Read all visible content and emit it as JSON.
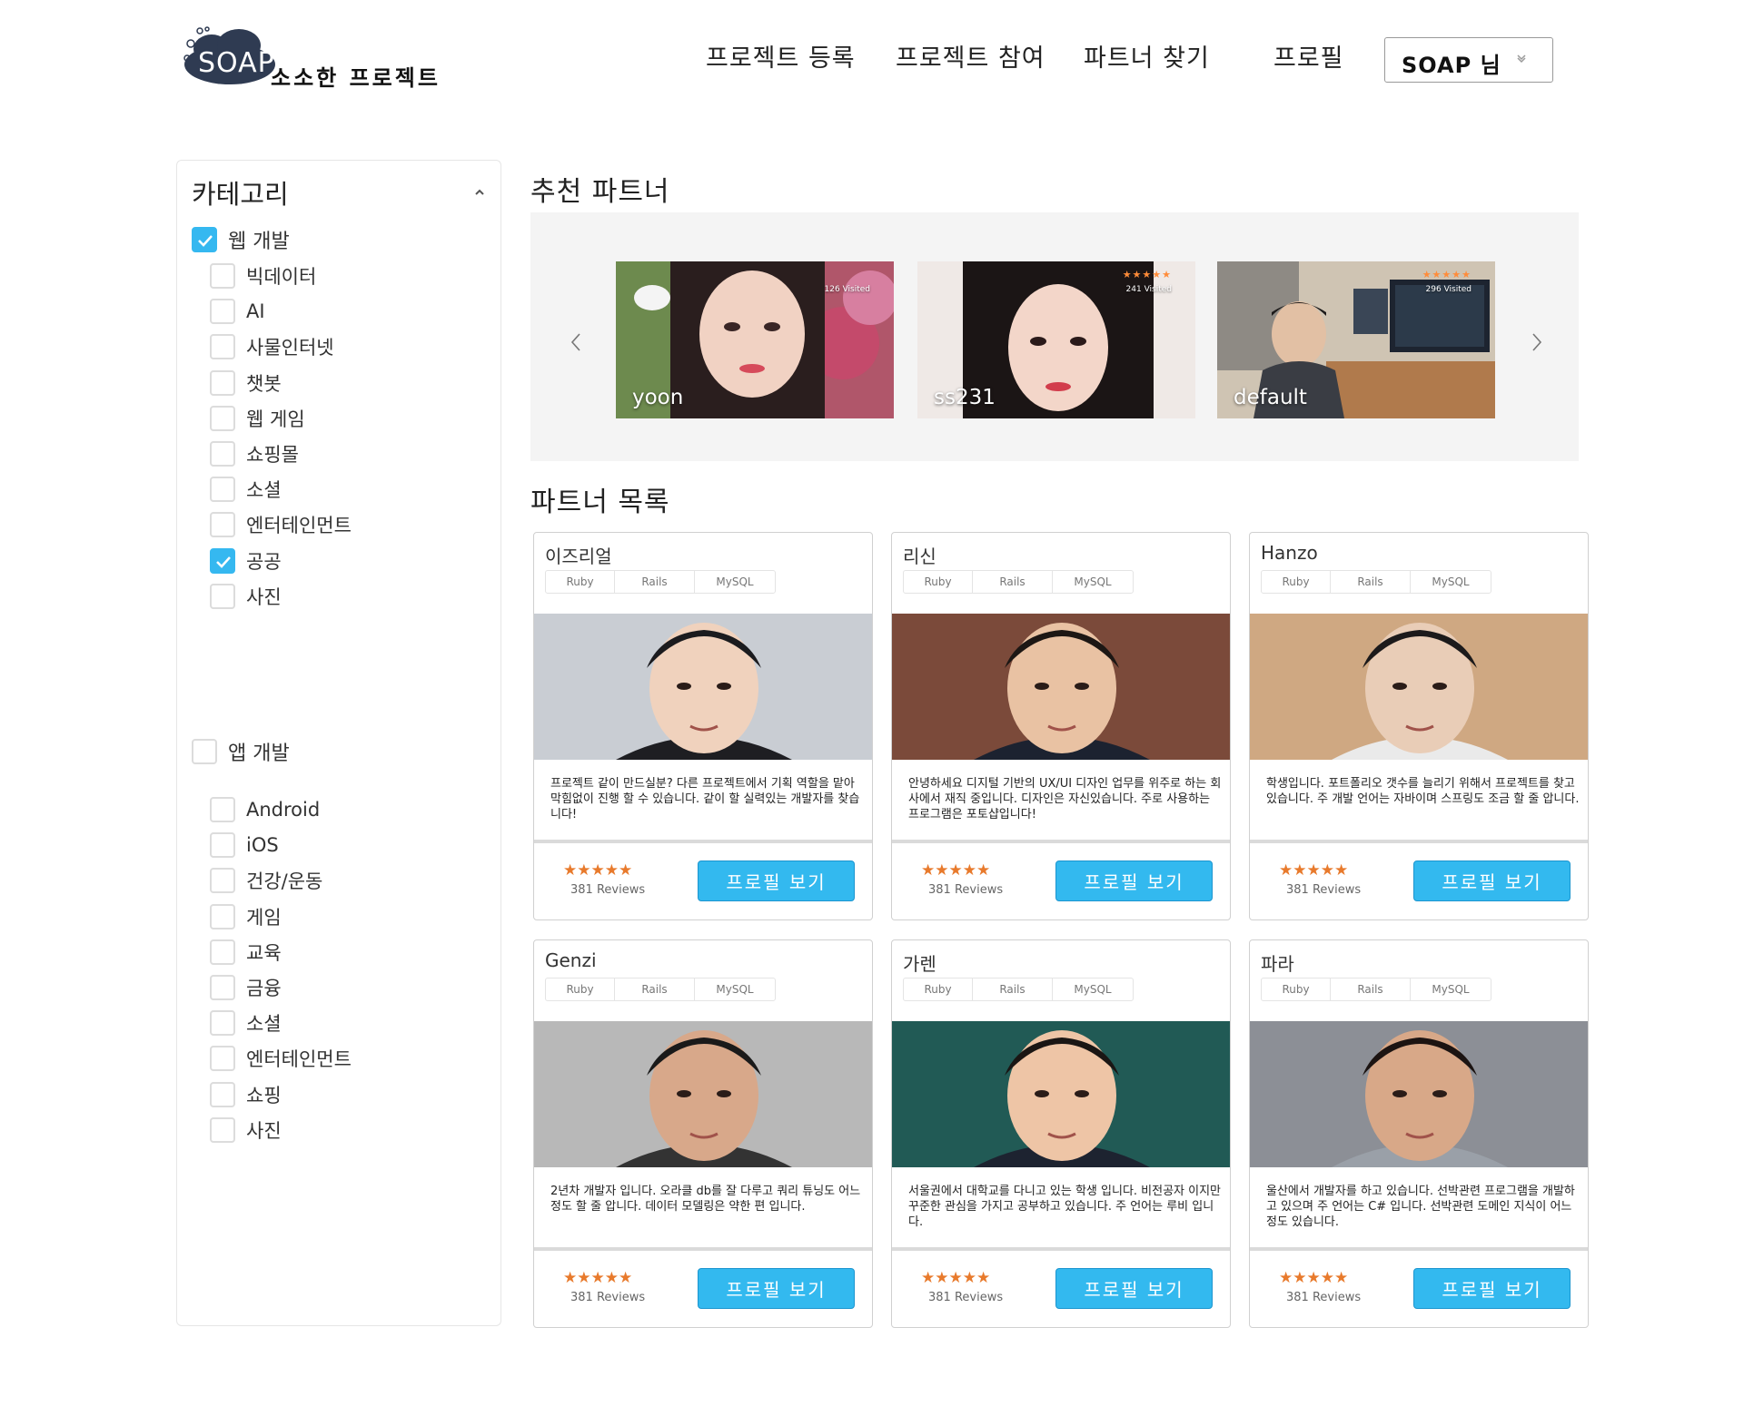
{
  "header": {
    "logo_badge": "SOAP",
    "logo_text": "소소한 프로젝트",
    "nav": {
      "register": "프로젝트 등록",
      "join": "프로젝트 참여",
      "find_partner": "파트너 찾기",
      "profile": "프로필"
    },
    "user_button": "SOAP 님"
  },
  "sidebar": {
    "title": "카테고리",
    "groups": [
      {
        "label": "웹 개발",
        "checked": true,
        "items": [
          {
            "label": "빅데이터",
            "checked": false
          },
          {
            "label": "AI",
            "checked": false
          },
          {
            "label": "사물인터넷",
            "checked": false
          },
          {
            "label": "챗봇",
            "checked": false
          },
          {
            "label": "웹 게임",
            "checked": false
          },
          {
            "label": "쇼핑몰",
            "checked": false
          },
          {
            "label": "소셜",
            "checked": false
          },
          {
            "label": "엔터테인먼트",
            "checked": false
          },
          {
            "label": "공공",
            "checked": true
          },
          {
            "label": "사진",
            "checked": false
          }
        ]
      },
      {
        "label": "앱 개발",
        "checked": false,
        "items": [
          {
            "label": "Android",
            "checked": false
          },
          {
            "label": "iOS",
            "checked": false
          },
          {
            "label": "건강/운동",
            "checked": false
          },
          {
            "label": "게임",
            "checked": false
          },
          {
            "label": "교육",
            "checked": false
          },
          {
            "label": "금융",
            "checked": false
          },
          {
            "label": "소셜",
            "checked": false
          },
          {
            "label": "엔터테인먼트",
            "checked": false
          },
          {
            "label": "쇼핑",
            "checked": false
          },
          {
            "label": "사진",
            "checked": false
          }
        ]
      }
    ]
  },
  "recommended": {
    "title": "추천 파트너",
    "partners": [
      {
        "name": "yoon",
        "visits": "126 Visited",
        "stars": ""
      },
      {
        "name": "ss231",
        "visits": "241 Visited",
        "stars": "★★★★★"
      },
      {
        "name": "default",
        "visits": "296 Visited",
        "stars": "★★★★★"
      }
    ]
  },
  "partner_list": {
    "title": "파트너 목록",
    "cards": [
      {
        "name": "이즈리얼",
        "tags": [
          "Ruby",
          "Rails",
          "MySQL"
        ],
        "description": "프로젝트 같이 만드실분? 다른 프로젝트에서 기획 역할을 맡아 막힘없이 진행 할 수 있습니다. 같이 할 실력있는 개발자를 찾습니다!",
        "stars": "★★★★★",
        "reviews": "381 Reviews",
        "button": "프로필 보기"
      },
      {
        "name": "리신",
        "tags": [
          "Ruby",
          "Rails",
          "MySQL"
        ],
        "description": "안녕하세요 디지털 기반의 UX/UI 디자인 업무를 위주로 하는 회사에서 재직 중입니다. 디자인은 자신있습니다. 주로 사용하는 프로그램은 포토샵입니다!",
        "stars": "★★★★★",
        "reviews": "381 Reviews",
        "button": "프로필 보기"
      },
      {
        "name": "Hanzo",
        "tags": [
          "Ruby",
          "Rails",
          "MySQL"
        ],
        "description": "학생입니다. 포트폴리오 갯수를 늘리기 위해서 프로젝트를 찾고 있습니다. 주 개발 언어는 자바이며 스프링도 조금 할 줄 압니다.",
        "stars": "★★★★★",
        "reviews": "381 Reviews",
        "button": "프로필 보기"
      },
      {
        "name": "Genzi",
        "tags": [
          "Ruby",
          "Rails",
          "MySQL"
        ],
        "description": "2년차 개발자 입니다. 오라클 db를 잘 다루고 쿼리 튜닝도 어느정도 할 줄 압니다. 데이터 모델링은 약한 편 입니다.",
        "stars": "★★★★★",
        "reviews": "381 Reviews",
        "button": "프로필 보기"
      },
      {
        "name": "가렌",
        "tags": [
          "Ruby",
          "Rails",
          "MySQL"
        ],
        "description": "서울권에서 대학교를 다니고 있는 학생 입니다. 비전공자 이지만 꾸준한 관심을 가지고 공부하고 있습니다. 주 언어는 루비 입니다.",
        "stars": "★★★★★",
        "reviews": "381 Reviews",
        "button": "프로필 보기"
      },
      {
        "name": "파라",
        "tags": [
          "Ruby",
          "Rails",
          "MySQL"
        ],
        "description": "울산에서 개발자를 하고 있습니다. 선박관련 프로그램을 개발하고 있으며 주 언어는 C# 입니다. 선박관련 도메인 지식이 어느정도 있습니다.",
        "stars": "★★★★★",
        "reviews": "381 Reviews",
        "button": "프로필 보기"
      }
    ]
  },
  "colors": {
    "accent": "#33b9ef",
    "star": "#e87a2c",
    "logo_dark": "#2f3b52"
  }
}
